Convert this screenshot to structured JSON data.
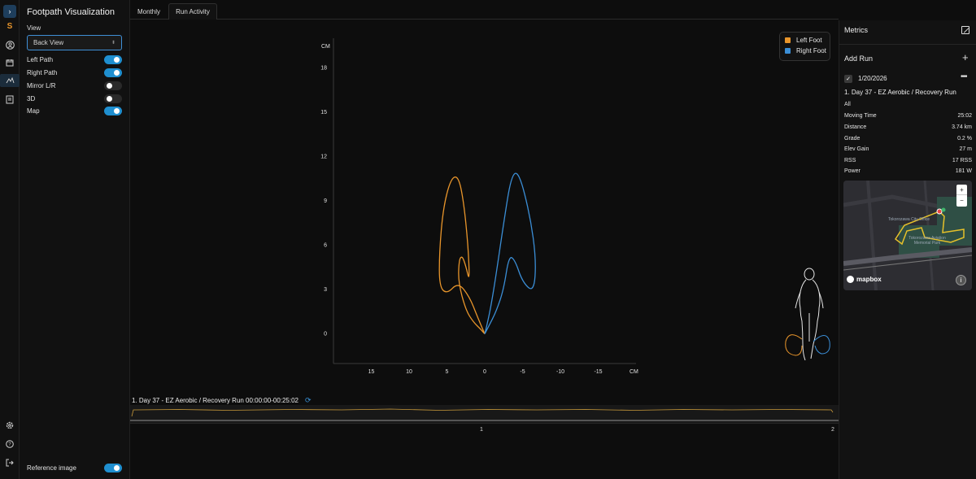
{
  "app": {
    "title": "Footpath Visualization",
    "brand_icon": "S"
  },
  "rail": {
    "icons": [
      "chevron-right-icon",
      "brand-logo",
      "profile-icon",
      "calendar-icon",
      "footpath-icon",
      "report-icon",
      "settings-icon",
      "help-icon",
      "logout-icon"
    ]
  },
  "panel": {
    "view_label": "View",
    "view_value": "Back View",
    "toggles": [
      {
        "label": "Left Path",
        "on": true
      },
      {
        "label": "Right Path",
        "on": true
      },
      {
        "label": "Mirror L/R",
        "on": false
      },
      {
        "label": "3D",
        "on": false
      },
      {
        "label": "Map",
        "on": true
      }
    ],
    "reference_label": "Reference image",
    "reference_on": true
  },
  "tabs": [
    {
      "label": "Monthly",
      "selected": false
    },
    {
      "label": "Run Activity",
      "selected": true
    }
  ],
  "chart_data": {
    "type": "line",
    "ylabel": "CM",
    "xlabel": "CM",
    "x_ticks": [
      15,
      10,
      5,
      0,
      -5,
      -10,
      -15
    ],
    "y_ticks": [
      0,
      3,
      6,
      9,
      12,
      15,
      18
    ],
    "xlim": [
      20,
      -20
    ],
    "ylim": [
      -2,
      20
    ],
    "legend_position": "top-right",
    "series": [
      {
        "name": "Left Foot",
        "color": "#e8952b",
        "points": [
          [
            0,
            0
          ],
          [
            0.5,
            0.3
          ],
          [
            1.5,
            0.8
          ],
          [
            2.5,
            1.6
          ],
          [
            3.5,
            3.5
          ],
          [
            3.4,
            5.0
          ],
          [
            3.0,
            5.3
          ],
          [
            2.5,
            4.6
          ],
          [
            2.0,
            3.5
          ],
          [
            2.2,
            6.0
          ],
          [
            2.8,
            9.0
          ],
          [
            3.5,
            10.7
          ],
          [
            4.5,
            10.5
          ],
          [
            5.5,
            8.5
          ],
          [
            6.0,
            5.5
          ],
          [
            6.0,
            3.2
          ],
          [
            5.0,
            2.7
          ],
          [
            3.5,
            3.5
          ],
          [
            2.0,
            2.5
          ],
          [
            1.0,
            1.2
          ],
          [
            0,
            0
          ]
        ]
      },
      {
        "name": "Right Foot",
        "color": "#3b8ed6",
        "points": [
          [
            0,
            0
          ],
          [
            -0.5,
            0.5
          ],
          [
            -1.5,
            1.5
          ],
          [
            -2.5,
            3.0
          ],
          [
            -3.2,
            5.3
          ],
          [
            -4.0,
            5.0
          ],
          [
            -5.0,
            3.5
          ],
          [
            -6.5,
            2.8
          ],
          [
            -6.8,
            5.0
          ],
          [
            -6.0,
            8.0
          ],
          [
            -4.5,
            11.0
          ],
          [
            -3.5,
            10.7
          ],
          [
            -2.5,
            7.5
          ],
          [
            -1.5,
            4.0
          ],
          [
            -0.8,
            1.8
          ],
          [
            -0.2,
            0.4
          ],
          [
            0,
            0
          ]
        ]
      }
    ]
  },
  "timeline": {
    "title": "1. Day 37 - EZ Aerobic / Recovery Run 00:00:00-00:25:02",
    "ticks": [
      "1",
      "2"
    ]
  },
  "metrics": {
    "title": "Metrics",
    "add_run": "Add Run",
    "run_date": "1/20/2026",
    "run_name": "1. Day 37 - EZ Aerobic / Recovery Run",
    "scope": "All",
    "rows": [
      {
        "label": "Moving Time",
        "value": "25:02"
      },
      {
        "label": "Distance",
        "value": "3.74 km"
      },
      {
        "label": "Grade",
        "value": "0.2 %"
      },
      {
        "label": "Elev Gain",
        "value": "27 m"
      },
      {
        "label": "RSS",
        "value": "17 RSS"
      },
      {
        "label": "Power",
        "value": "181 W"
      }
    ],
    "map": {
      "zoom_in": "+",
      "zoom_out": "−",
      "attribution": "mapbox",
      "info": "i",
      "labels": [
        "Tokorozawa City Office",
        "Tokorozawa Aviation Memorial Park"
      ]
    }
  }
}
